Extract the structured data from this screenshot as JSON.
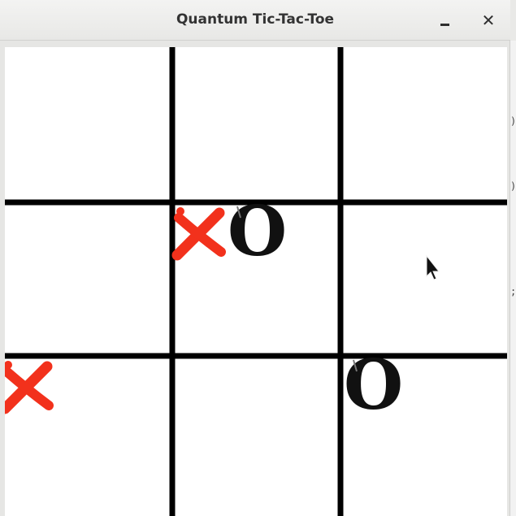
{
  "window": {
    "title": "Quantum Tic-Tac-Toe",
    "minimize_icon": "minimize-icon",
    "close_icon": "close-icon",
    "close_glyph": "✕"
  },
  "board": {
    "rows": 3,
    "cols": 3,
    "line_color": "#000000",
    "background": "#ffffff",
    "x_mark_color": "#f2311c",
    "o_mark_color": "#111111",
    "o_glyph": "O",
    "cells": [
      {
        "row": 0,
        "col": 0,
        "marks": []
      },
      {
        "row": 0,
        "col": 1,
        "marks": []
      },
      {
        "row": 0,
        "col": 2,
        "marks": []
      },
      {
        "row": 1,
        "col": 0,
        "marks": []
      },
      {
        "row": 1,
        "col": 1,
        "marks": [
          "X",
          "O"
        ]
      },
      {
        "row": 1,
        "col": 2,
        "marks": []
      },
      {
        "row": 2,
        "col": 0,
        "marks": [
          "X"
        ]
      },
      {
        "row": 2,
        "col": 1,
        "marks": []
      },
      {
        "row": 2,
        "col": 2,
        "marks": [
          "O"
        ]
      }
    ]
  },
  "cursor": {
    "icon": "mouse-pointer-icon"
  }
}
